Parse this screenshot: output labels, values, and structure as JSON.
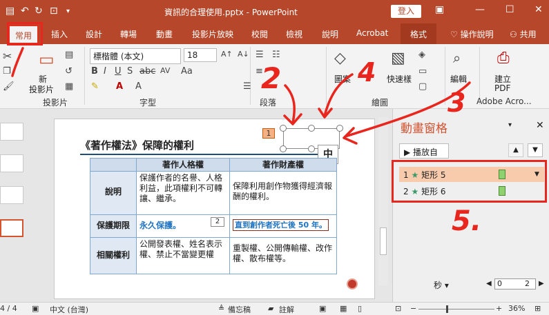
{
  "window": {
    "title": "資訊的合理使用.pptx - PowerPoint",
    "login": "登入"
  },
  "tabs": [
    "常用",
    "插入",
    "設計",
    "轉場",
    "動畫",
    "投影片放映",
    "校閱",
    "檢視",
    "說明",
    "Acrobat",
    "格式"
  ],
  "tell_me": "操作說明",
  "share": "共用",
  "ribbon": {
    "new_slide": "新",
    "new_slide_line2": "投影片",
    "font_name": "標楷體 (本文)",
    "font_size": "18",
    "groups": {
      "slides": "投影片",
      "font": "字型",
      "paragraph": "段落",
      "drawing": "繪圖",
      "adobe": "Adobe Acro..."
    },
    "shape": "圖案",
    "quick_style": "快速樣",
    "edit": "編輯",
    "create_pdf": "建立",
    "create_pdf_line2": "PDF"
  },
  "slide": {
    "title": "《著作權法》保障的權利",
    "tag1": "1",
    "zhong": "中",
    "table": {
      "col1": "著作人格權",
      "col2": "著作財產權",
      "rows": [
        {
          "label": "說明",
          "c1": "保護作者的名譽、人格利益，此項權利不可轉讓、繼承。",
          "c2": "保障利用創作物獲得經濟報酬的權利。"
        },
        {
          "label": "保護期限",
          "c1": "永久保護。",
          "c2": "直到創作者死亡後 50 年。"
        },
        {
          "label": "相關權利",
          "c1": "公開發表權、姓名表示權、禁止不當變更權",
          "c2": "重製權、公開傳輸權、改作權、散布權等。"
        }
      ],
      "tag2": "2"
    }
  },
  "anim_pane": {
    "title": "動畫窗格",
    "play": "播放自",
    "items": [
      {
        "num": "1",
        "name": "矩形 5"
      },
      {
        "num": "2",
        "name": "矩形 6"
      }
    ],
    "seconds": "秒",
    "page_from": "0",
    "page_to": "2"
  },
  "status": {
    "slide_no": "4 / 4",
    "language": "中文 (台灣)",
    "notes": "備忘稿",
    "comments": "註解",
    "zoom": "36%"
  },
  "annotations": {
    "n1": "1",
    "n2": "2",
    "n3": "3",
    "n4": "4",
    "n5": "5."
  }
}
